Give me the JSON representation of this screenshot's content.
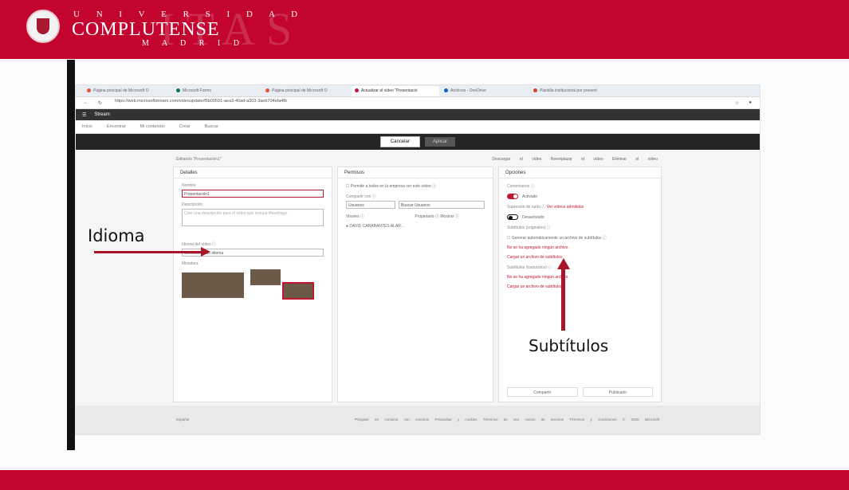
{
  "banner": {
    "university_top": "U N I V E R S I D A D",
    "university_main": "COMPLUTENSE",
    "university_city": "M A D R I D",
    "watermark": "ITAS"
  },
  "browser": {
    "tabs": [
      "Página principal de Microsoft O",
      "Microsoft Forms",
      "Página principal de Microsoft O",
      "Actualizar el vídeo \"Presentació",
      "Archivos - OneDrive",
      "Plantilla institucional por present"
    ],
    "active_tab_index": 3,
    "address": "https://web.microsoftstream.com/videoupdate/f5b09591-aea3-40ad-a303-3aeb704efa4fb"
  },
  "stream": {
    "app_name": "Stream",
    "nav": [
      "Inicio",
      "Encontrar",
      "Mi contenido",
      "Crear",
      "Buscar"
    ],
    "cancel": "Cancelar",
    "apply": "Aplicar",
    "editing": "Editando \"Presentación1\"",
    "top_actions": [
      "Descargar el vídeo",
      "Reemplazar el vídeo",
      "Eliminar el vídeo"
    ]
  },
  "details": {
    "title": "Detalles",
    "name_label": "Nombre",
    "name_value": "Presentación1",
    "description_label": "Descripción",
    "description_placeholder": "Cree una descripción para el vídeo que incluya #hashtags.",
    "language_label": "Idioma del vídeo ⓘ",
    "language_value": "Seleccionar un idioma",
    "thumbnail_label": "Miniatura"
  },
  "permissions": {
    "title": "Permisos",
    "allow_all": "Permitir a todos en la empresa ver este vídeo ⓘ",
    "share_with": "Compartir con ⓘ",
    "users": "Usuarios",
    "search_users": "Buscar Usuarios",
    "viewers": "Visores ⓘ",
    "owner": "Propietario ⓘ",
    "show": "Mostrar ⓘ",
    "user_name": "DAVID CARABANTES ALAR..."
  },
  "options": {
    "title": "Opciones",
    "comments": "Comentarios ⓘ",
    "comments_state": "Activado",
    "noise": "Supresión de ruido ⓘ",
    "noise_link": "Ver vídeos admitidos",
    "noise_state": "Desactivado",
    "subtitles_original": "Subtítulos (originales) ⓘ",
    "auto_subtitles": "Generar automáticamente un archivo de subtítulos ⓘ",
    "not_added": "No se ha agregado ningún archivo",
    "upload_subtitles": "Cargar un archivo de subtítulos",
    "subtitles_translated": "Subtítulos (traducidos) ⓘ",
    "share": "Compartir",
    "published": "Publicado"
  },
  "footer": {
    "language": "Español",
    "links": "Póngase en contacto con nosotros   Privacidad y cookies   Términos de uso   Avisos de terceros   Términos y condiciones   © 2020 Microsoft"
  },
  "annotations": {
    "idioma": "Idioma",
    "subtitulos": "Subtítulos"
  }
}
